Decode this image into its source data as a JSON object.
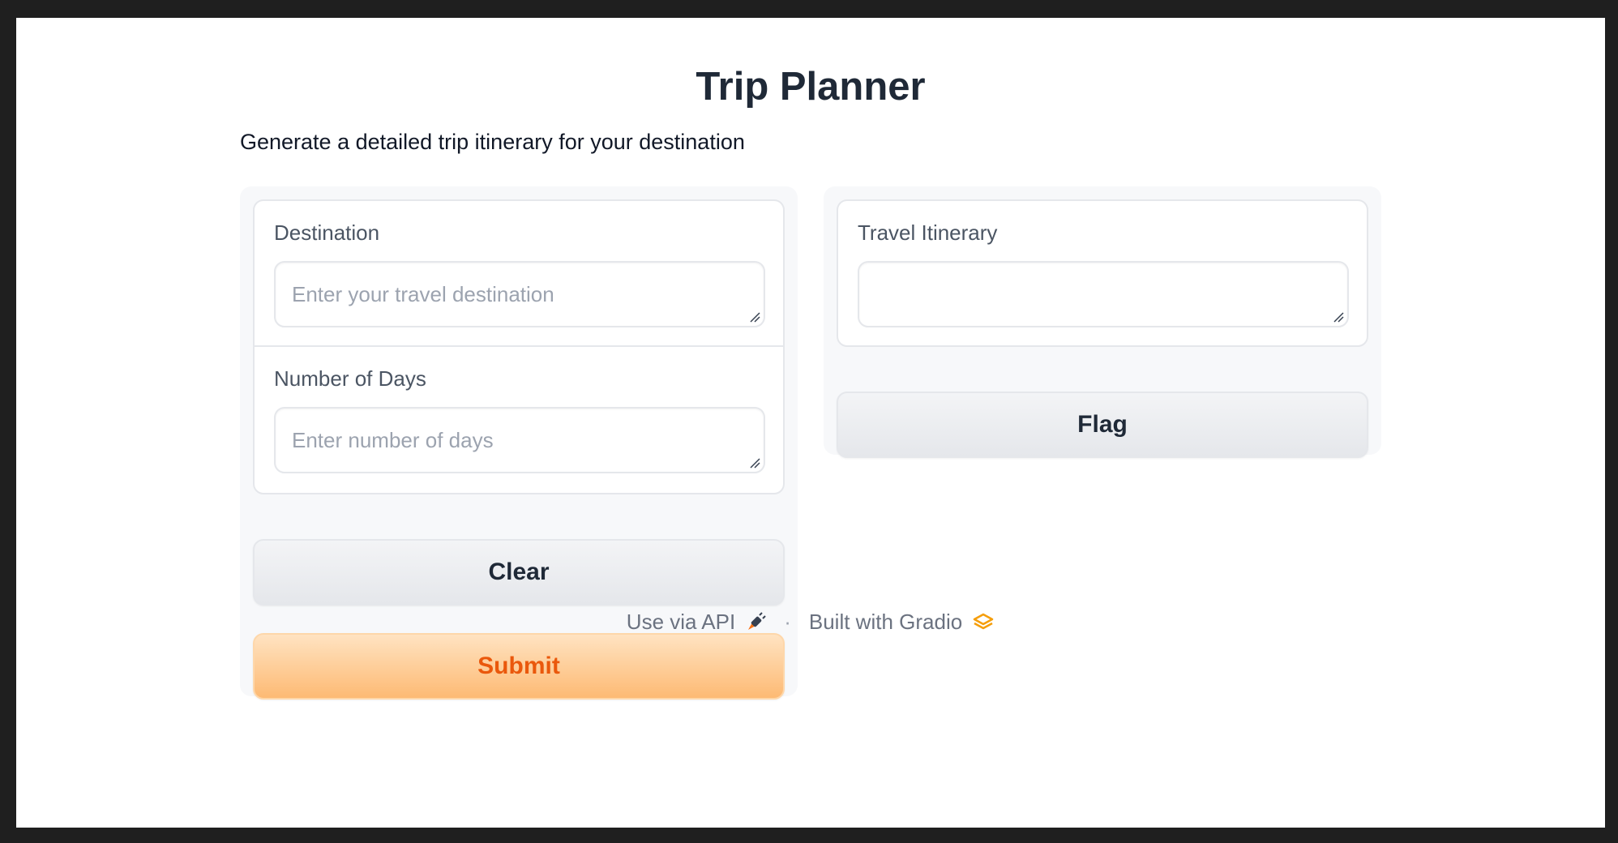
{
  "app": {
    "title": "Trip Planner",
    "description": "Generate a detailed trip itinerary for your destination"
  },
  "inputs": {
    "destination": {
      "label": "Destination",
      "value": "",
      "placeholder": "Enter your travel destination"
    },
    "days": {
      "label": "Number of Days",
      "value": "",
      "placeholder": "Enter number of days"
    }
  },
  "buttons": {
    "clear_label": "Clear",
    "submit_label": "Submit",
    "flag_label": "Flag"
  },
  "output": {
    "label": "Travel Itinerary",
    "value": ""
  },
  "footer": {
    "api_label": "Use via API",
    "separator": "·",
    "built_label": "Built with Gradio",
    "api_icon": "rocket-icon",
    "gradio_icon": "gradio-logo-icon"
  },
  "colors": {
    "accent": "#ea580c",
    "primary_gradient_start": "#ffe3c2",
    "primary_gradient_end": "#fdba74",
    "gradio_orange": "#f59e0b"
  }
}
